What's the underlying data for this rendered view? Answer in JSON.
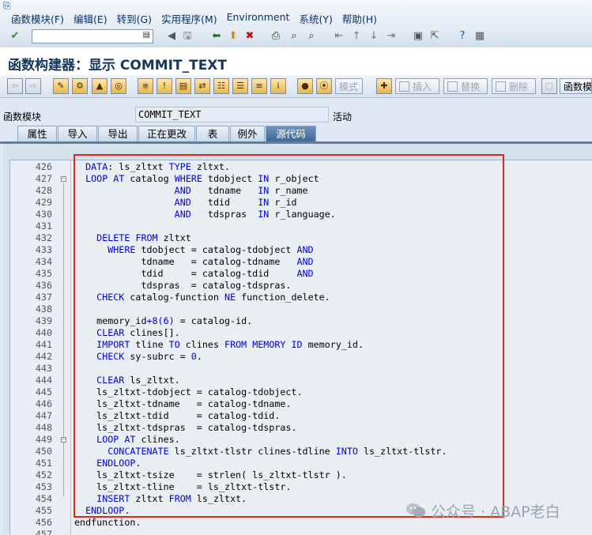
{
  "menu": {
    "items": [
      "函数模块(F)",
      "编辑(E)",
      "转到(G)",
      "实用程序(M)",
      "Environment",
      "系统(Y)",
      "帮助(H)"
    ]
  },
  "toolbar": {
    "command_value": ""
  },
  "title": "函数构建器：显示 COMMIT_TEXT",
  "app_toolbar": {
    "mode_label": "模式",
    "insert_label": "插入",
    "replace_label": "替换",
    "delete_label": "删除",
    "function_module_label": "函数模"
  },
  "header": {
    "fm_label": "函数模块",
    "fm_name": "COMMIT_TEXT",
    "status": "活动"
  },
  "tabs": [
    {
      "label": "属性",
      "active": false
    },
    {
      "label": "导入",
      "active": false
    },
    {
      "label": "导出",
      "active": false
    },
    {
      "label": "正在更改",
      "active": false
    },
    {
      "label": "表",
      "active": false
    },
    {
      "label": "例外",
      "active": false
    },
    {
      "label": "源代码",
      "active": true
    }
  ],
  "code_lines": [
    {
      "n": "426",
      "fold": false,
      "t": "  DATA: ls_zltxt TYPE zltxt."
    },
    {
      "n": "427",
      "fold": true,
      "t": "  LOOP AT catalog WHERE tdobject IN r_object"
    },
    {
      "n": "428",
      "fold": false,
      "t": "                  AND   tdname   IN r_name"
    },
    {
      "n": "429",
      "fold": false,
      "t": "                  AND   tdid     IN r_id"
    },
    {
      "n": "430",
      "fold": false,
      "t": "                  AND   tdspras  IN r_language."
    },
    {
      "n": "431",
      "fold": false,
      "t": ""
    },
    {
      "n": "432",
      "fold": false,
      "t": "    DELETE FROM zltxt"
    },
    {
      "n": "433",
      "fold": false,
      "t": "      WHERE tdobject = catalog-tdobject AND"
    },
    {
      "n": "434",
      "fold": false,
      "t": "            tdname   = catalog-tdname   AND"
    },
    {
      "n": "435",
      "fold": false,
      "t": "            tdid     = catalog-tdid     AND"
    },
    {
      "n": "436",
      "fold": false,
      "t": "            tdspras  = catalog-tdspras."
    },
    {
      "n": "437",
      "fold": false,
      "t": "    CHECK catalog-function NE function_delete."
    },
    {
      "n": "438",
      "fold": false,
      "t": ""
    },
    {
      "n": "439",
      "fold": false,
      "t": "    memory_id+8(6) = catalog-id."
    },
    {
      "n": "440",
      "fold": false,
      "t": "    CLEAR clines[]."
    },
    {
      "n": "441",
      "fold": false,
      "t": "    IMPORT tline TO clines FROM MEMORY ID memory_id."
    },
    {
      "n": "442",
      "fold": false,
      "t": "    CHECK sy-subrc = 0."
    },
    {
      "n": "443",
      "fold": false,
      "t": ""
    },
    {
      "n": "444",
      "fold": false,
      "t": "    CLEAR ls_zltxt."
    },
    {
      "n": "445",
      "fold": false,
      "t": "    ls_zltxt-tdobject = catalog-tdobject."
    },
    {
      "n": "446",
      "fold": false,
      "t": "    ls_zltxt-tdname   = catalog-tdname."
    },
    {
      "n": "447",
      "fold": false,
      "t": "    ls_zltxt-tdid     = catalog-tdid."
    },
    {
      "n": "448",
      "fold": false,
      "t": "    ls_zltxt-tdspras  = catalog-tdspras."
    },
    {
      "n": "449",
      "fold": true,
      "t": "    LOOP AT clines."
    },
    {
      "n": "450",
      "fold": false,
      "t": "      CONCATENATE ls_zltxt-tlstr clines-tdline INTO ls_zltxt-tlstr."
    },
    {
      "n": "451",
      "fold": false,
      "t": "    ENDLOOP."
    },
    {
      "n": "452",
      "fold": false,
      "t": "    ls_zltxt-tsize    = strlen( ls_zltxt-tlstr )."
    },
    {
      "n": "453",
      "fold": false,
      "t": "    ls_zltxt-tline    = ls_zltxt-tlstr."
    },
    {
      "n": "454",
      "fold": false,
      "t": "    INSERT zltxt FROM ls_zltxt."
    },
    {
      "n": "455",
      "fold": false,
      "t": "  ENDLOOP."
    },
    {
      "n": "456",
      "fold": false,
      "t": "endfunction."
    },
    {
      "n": "457",
      "fold": false,
      "t": ""
    }
  ],
  "watermark": "公众号 · ABAP老白",
  "colors": {
    "keyword": "#0000e6",
    "highlight_box": "#e0281e",
    "tab_active": "#3d6594"
  }
}
